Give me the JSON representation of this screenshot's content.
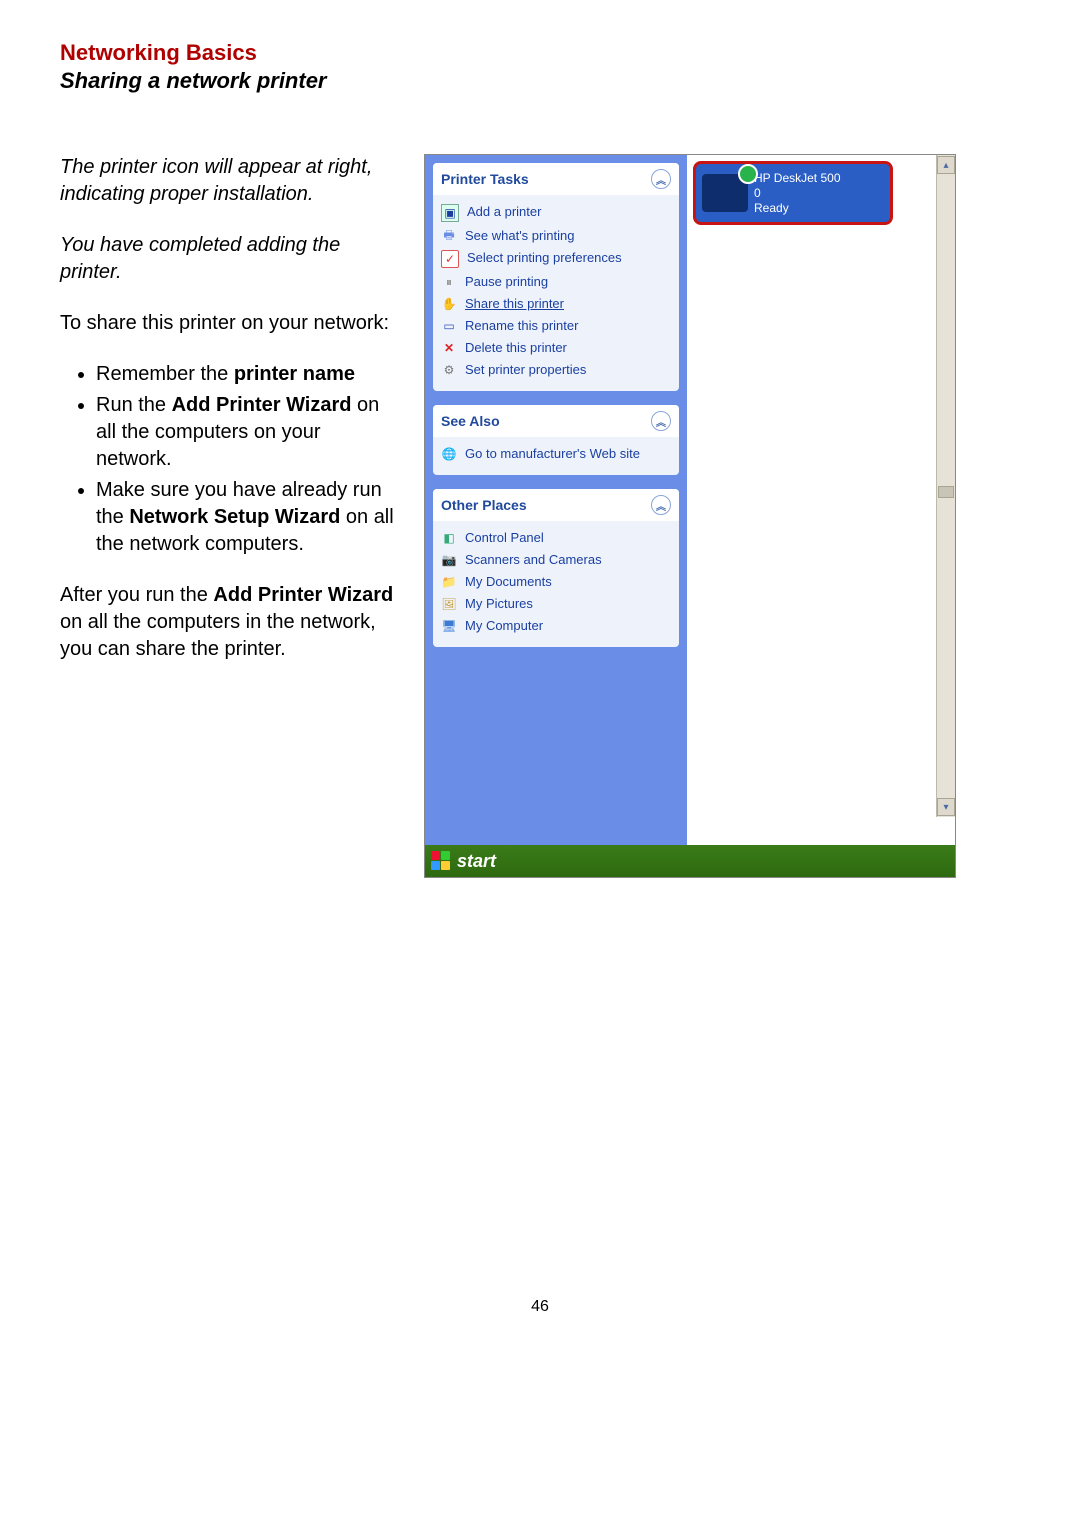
{
  "doc": {
    "title_red": "Networking Basics",
    "title_sub": "Sharing a network printer",
    "para1": "The printer icon will appear at right, indicating proper installation.",
    "para2": "You have completed adding the printer.",
    "para3_intro": "To share this printer on your network:",
    "bullets": {
      "b1_a": "Remember the ",
      "b1_b": "printer name",
      "b2_a": "Run the ",
      "b2_b": "Add Printer Wizard",
      "b2_c": " on all the computers on your network.",
      "b3_a": "Make sure you have already run the ",
      "b3_b": "Network Setup Wizard",
      "b3_c": " on all the network computers."
    },
    "para4_a": "After you run the ",
    "para4_b": "Add Printer Wizard",
    "para4_c": " on all the computers in the network, you can share the printer.",
    "page_number": "46"
  },
  "xp": {
    "printer_tasks_header": "Printer Tasks",
    "tasks": [
      "Add a printer",
      "See what's printing",
      "Select printing preferences",
      "Pause printing",
      "Share this printer",
      "Rename this printer",
      "Delete this printer",
      "Set printer properties"
    ],
    "see_also_header": "See Also",
    "see_also_item": "Go to manufacturer's Web site",
    "other_places_header": "Other Places",
    "other_places": [
      "Control Panel",
      "Scanners and Cameras",
      "My Documents",
      "My Pictures",
      "My Computer"
    ],
    "printer_name": "HP DeskJet 500",
    "printer_docs": "0",
    "printer_status": "Ready",
    "start": "start"
  }
}
